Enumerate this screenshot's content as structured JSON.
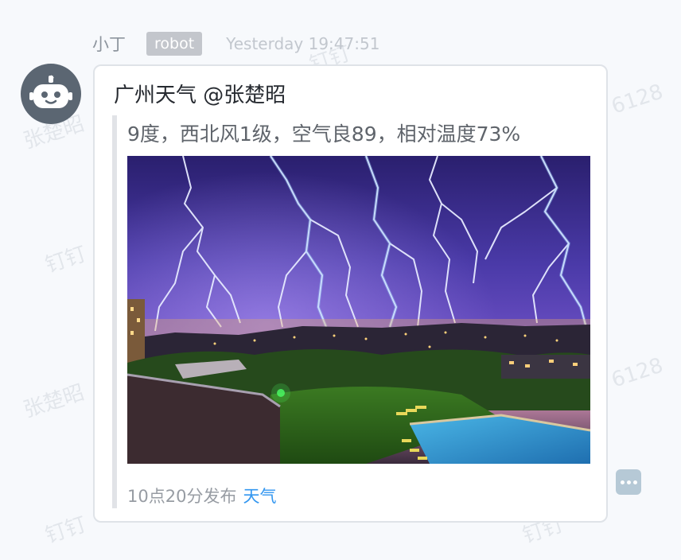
{
  "message": {
    "sender": "小丁",
    "tag": "robot",
    "timestamp": "Yesterday 19:47:51",
    "avatar_icon": "robot-icon"
  },
  "card": {
    "title": "广州天气 @张楚昭",
    "summary": "9度，西北风1级，空气良89，相对温度73%",
    "image_description_icon": "lightning-photo",
    "footer_text": "10点20分发布",
    "footer_link": "天气",
    "link_color": "#3296f0"
  },
  "actions": {
    "more_icon": "more-icon"
  },
  "watermarks": [
    "钉钉",
    "6128",
    "张楚昭",
    "钉钉",
    "张楚昭",
    "6128",
    "钉钉",
    "钉钉"
  ]
}
